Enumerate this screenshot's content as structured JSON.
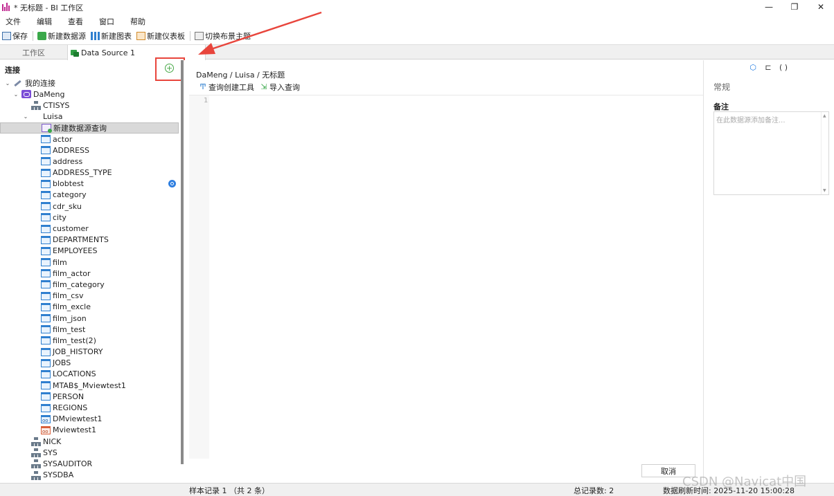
{
  "window": {
    "title": "* 无标题 - BI 工作区",
    "minimize": "—",
    "maximize": "❐",
    "close": "✕"
  },
  "menu": [
    "文件",
    "编辑",
    "查看",
    "窗口",
    "帮助"
  ],
  "toolbar": {
    "save": "保存",
    "new_datasource": "新建数据源",
    "new_chart": "新建图表",
    "new_dashboard": "新建仪表板",
    "switch_theme": "切换布景主题"
  },
  "tabs": {
    "workspace": "工作区",
    "datasource": "Data Source 1"
  },
  "left_panel": {
    "header": "连接",
    "add_icon": "+",
    "tree": [
      {
        "level": 0,
        "twisty": "v",
        "icon": "conn",
        "label": "我的连接"
      },
      {
        "level": 1,
        "twisty": "v",
        "icon": "dm",
        "label": "DaMeng"
      },
      {
        "level": 2,
        "twisty": "",
        "icon": "schema",
        "label": "CTISYS"
      },
      {
        "level": 2,
        "twisty": "v",
        "icon": "schema-green",
        "label": "Luisa"
      },
      {
        "level": 3,
        "twisty": "",
        "icon": "query",
        "label": "新建数据源查询",
        "selected": true
      },
      {
        "level": 3,
        "twisty": "",
        "icon": "table",
        "label": "actor"
      },
      {
        "level": 3,
        "twisty": "",
        "icon": "table",
        "label": "ADDRESS"
      },
      {
        "level": 3,
        "twisty": "",
        "icon": "table",
        "label": "address"
      },
      {
        "level": 3,
        "twisty": "",
        "icon": "table",
        "label": "ADDRESS_TYPE"
      },
      {
        "level": 3,
        "twisty": "",
        "icon": "table",
        "label": "blobtest",
        "badge": true
      },
      {
        "level": 3,
        "twisty": "",
        "icon": "table",
        "label": "category"
      },
      {
        "level": 3,
        "twisty": "",
        "icon": "table",
        "label": "cdr_sku"
      },
      {
        "level": 3,
        "twisty": "",
        "icon": "table",
        "label": "city"
      },
      {
        "level": 3,
        "twisty": "",
        "icon": "table",
        "label": "customer"
      },
      {
        "level": 3,
        "twisty": "",
        "icon": "table",
        "label": "DEPARTMENTS"
      },
      {
        "level": 3,
        "twisty": "",
        "icon": "table",
        "label": "EMPLOYEES"
      },
      {
        "level": 3,
        "twisty": "",
        "icon": "table",
        "label": "film"
      },
      {
        "level": 3,
        "twisty": "",
        "icon": "table",
        "label": "film_actor"
      },
      {
        "level": 3,
        "twisty": "",
        "icon": "table",
        "label": "film_category"
      },
      {
        "level": 3,
        "twisty": "",
        "icon": "table",
        "label": "film_csv"
      },
      {
        "level": 3,
        "twisty": "",
        "icon": "table",
        "label": "film_excle"
      },
      {
        "level": 3,
        "twisty": "",
        "icon": "table",
        "label": "film_json"
      },
      {
        "level": 3,
        "twisty": "",
        "icon": "table",
        "label": "film_test"
      },
      {
        "level": 3,
        "twisty": "",
        "icon": "table",
        "label": "film_test(2)"
      },
      {
        "level": 3,
        "twisty": "",
        "icon": "table",
        "label": "JOB_HISTORY"
      },
      {
        "level": 3,
        "twisty": "",
        "icon": "table",
        "label": "JOBS"
      },
      {
        "level": 3,
        "twisty": "",
        "icon": "table",
        "label": "LOCATIONS"
      },
      {
        "level": 3,
        "twisty": "",
        "icon": "table",
        "label": "MTAB$_Mviewtest1"
      },
      {
        "level": 3,
        "twisty": "",
        "icon": "table",
        "label": "PERSON"
      },
      {
        "level": 3,
        "twisty": "",
        "icon": "table",
        "label": "REGIONS"
      },
      {
        "level": 3,
        "twisty": "",
        "icon": "view",
        "label": "DMviewtest1"
      },
      {
        "level": 3,
        "twisty": "",
        "icon": "mview",
        "label": "Mviewtest1"
      },
      {
        "level": 2,
        "twisty": "",
        "icon": "schema",
        "label": "NICK"
      },
      {
        "level": 2,
        "twisty": "",
        "icon": "schema",
        "label": "SYS"
      },
      {
        "level": 2,
        "twisty": "",
        "icon": "schema",
        "label": "SYSAUDITOR"
      },
      {
        "level": 2,
        "twisty": "",
        "icon": "schema",
        "label": "SYSDBA"
      }
    ]
  },
  "center": {
    "breadcrumb": "DaMeng / Luisa / 无标题",
    "query_builder": "查询创建工具",
    "import_query": "导入查询",
    "line_number": "1",
    "cancel": "取消"
  },
  "right_panel": {
    "section": "常规",
    "notes_label": "备注",
    "notes_placeholder": "在此数据源添加备注..."
  },
  "status": {
    "sample": "样本记录 1 （共 2 条）",
    "total": "总记录数: 2",
    "refresh": "数据刷新时间: 2025-11-20 15:00:28"
  },
  "watermark": "CSDN @Navicat中国",
  "colors": {
    "annotation_red": "#e8453c",
    "accent_blue": "#1f7ae0",
    "add_green": "#45a845"
  }
}
